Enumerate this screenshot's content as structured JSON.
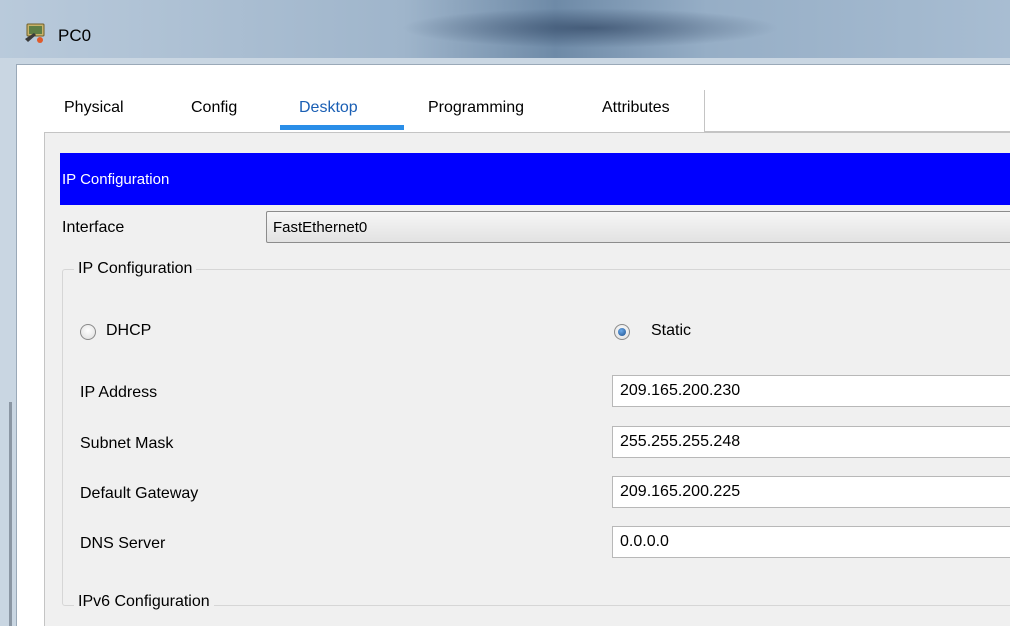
{
  "window": {
    "title": "PC0",
    "icon": "pc-device-icon"
  },
  "tabs": [
    {
      "label": "Physical"
    },
    {
      "label": "Config"
    },
    {
      "label": "Desktop",
      "active": true
    },
    {
      "label": "Programming"
    },
    {
      "label": "Attributes"
    }
  ],
  "ip_config": {
    "header": "IP Configuration",
    "interface_label": "Interface",
    "interface_value": "FastEthernet0",
    "group_title": "IP Configuration",
    "dhcp_label": "DHCP",
    "static_label": "Static",
    "mode": "Static",
    "ip_address_label": "IP Address",
    "ip_address": "209.165.200.230",
    "subnet_mask_label": "Subnet Mask",
    "subnet_mask": "255.255.255.248",
    "gateway_label": "Default Gateway",
    "gateway": "209.165.200.225",
    "dns_label": "DNS Server",
    "dns": "0.0.0.0",
    "ipv6_group_title": "IPv6 Configuration"
  },
  "colors": {
    "header_bg": "#0000ff",
    "active_tab_text": "#1a5fb4",
    "active_tab_underline": "#2a8ee8"
  }
}
